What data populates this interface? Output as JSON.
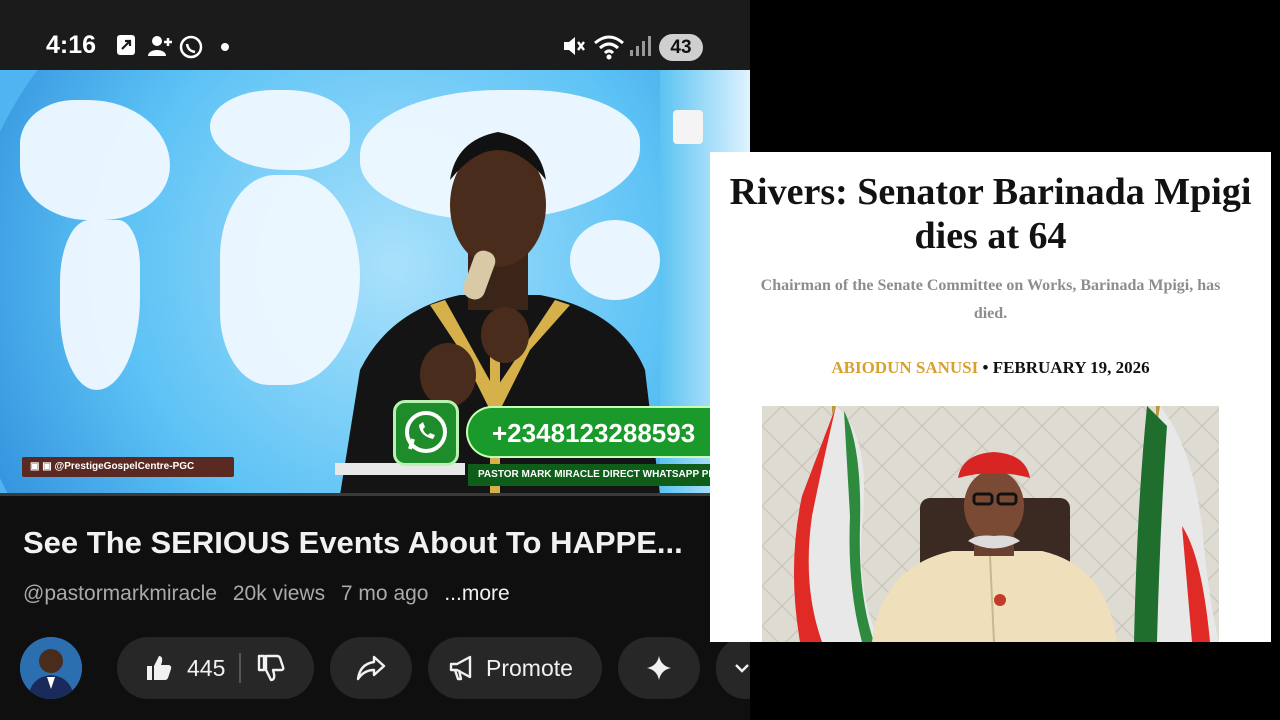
{
  "status_bar": {
    "time": "4:16",
    "battery": "43",
    "icons": [
      "share-icon",
      "person-add-icon",
      "whatsapp-icon",
      "dot-icon",
      "mute-icon",
      "wifi-icon",
      "signal-icon"
    ]
  },
  "video": {
    "watermark": "▣ ▣ @PrestigeGospelCentre-PGC",
    "phone_number": "+2348123288593",
    "prayer_line": "PASTOR MARK MIRACLE    DIRECT WHATSAPP PRAYER LINE",
    "progress": 0.0
  },
  "meta": {
    "title": "See The SERIOUS Events About To HAPPE...",
    "channel": "@pastormarkmiracle",
    "views": "20k views",
    "age": "7 mo ago",
    "more": "...more"
  },
  "actions": {
    "likes": "445",
    "promote": "Promote"
  },
  "article": {
    "headline": "Rivers: Senator Barinada Mpigi dies at 64",
    "subhead": "Chairman of the Senate Committee on Works, Barinada Mpigi, has died.",
    "author": "ABIODUN SANUSI",
    "separator": "•",
    "date": "FEBRUARY 19, 2026",
    "colors": {
      "author": "#d8a12f",
      "headline": "#121212",
      "subhead": "#8d8d8d"
    }
  },
  "colors": {
    "whatsapp_green": "#1a9a2a",
    "app_bg": "#0f0f0f",
    "pill_bg": "#272727"
  }
}
